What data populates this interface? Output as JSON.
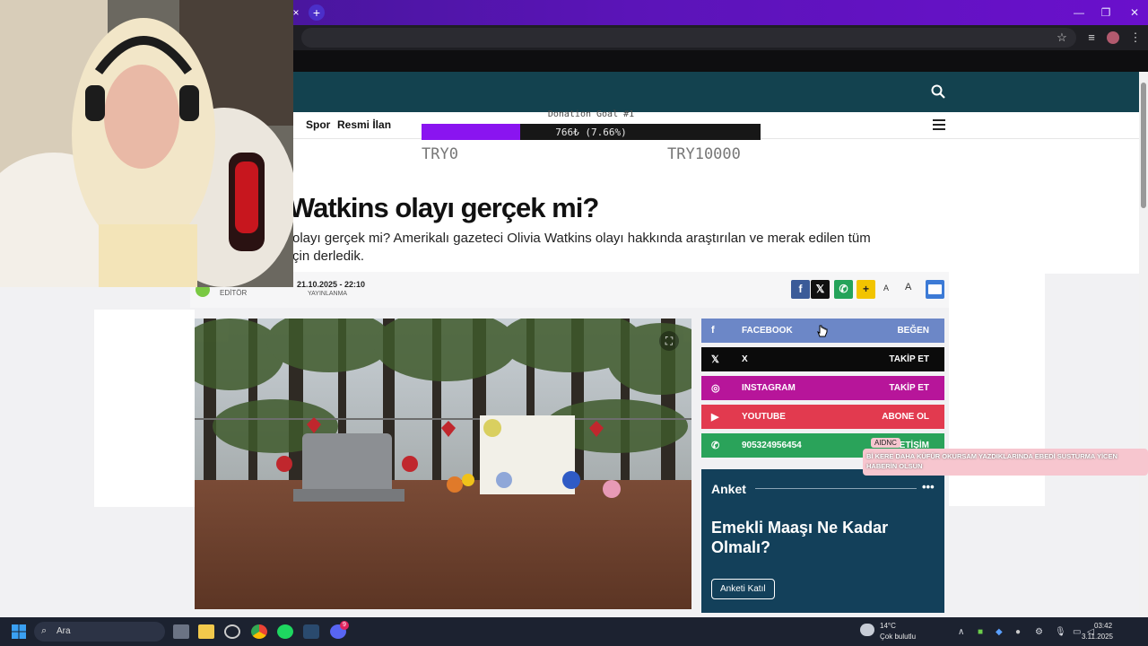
{
  "browser": {
    "tab_close": "×",
    "new_tab": "+",
    "window_buttons": [
      "—",
      "❐",
      "✕"
    ]
  },
  "site": {
    "nav_items": [
      "Spor",
      "Resmi İlan"
    ],
    "search_icon": "search-icon",
    "menu_icon": "hamburger-icon"
  },
  "article": {
    "title": "Watkins olayı gerçek mi?",
    "subtitle_line1": "olayı gerçek mi? Amerikalı gazeteci Olivia Watkins olayı hakkında araştırılan ve merak edilen tüm",
    "subtitle_line2": "çin derledik.",
    "author_role": "EDİTÖR",
    "date": "21.10.2025 - 22:10",
    "date_label": "YAYINLANMA",
    "font_small": "A",
    "font_large": "A",
    "share_buttons": [
      "f",
      "𝕏",
      "✆",
      "+"
    ]
  },
  "social": [
    {
      "icon": "facebook-icon",
      "glyph": "f",
      "name": "FACEBOOK",
      "action": "BEĞEN",
      "color": "#6c87c7"
    },
    {
      "icon": "x-icon",
      "glyph": "𝕏",
      "name": "X",
      "action": "TAKİP ET",
      "color": "#0b0b0b"
    },
    {
      "icon": "instagram-icon",
      "glyph": "◎",
      "name": "INSTAGRAM",
      "action": "TAKİP ET",
      "color": "#b7159a"
    },
    {
      "icon": "youtube-icon",
      "glyph": "▶",
      "name": "YOUTUBE",
      "action": "ABONE OL",
      "color": "#e23a4f"
    },
    {
      "icon": "whatsapp-icon",
      "glyph": "✆",
      "name": "905324956454",
      "action": "İLETİŞİM",
      "color": "#2aa35a"
    }
  ],
  "poll": {
    "header": "Anket",
    "question": "Emekli Maaşı Ne Kadar Olmalı?",
    "button": "Anketi Katıl"
  },
  "stream_overlay": {
    "goal_title": "Donation Goal #1",
    "progress_text": "766₺ (7.66%)",
    "progress_fraction": 0.0766,
    "start_label": "TRY0",
    "end_label": "TRY10000",
    "alert_title": "AIDNC",
    "alert_text": "Bİ KERE DAHA KÜFÜR OKURSAM YAZDIKLARINDA EBEDİ SUSTURMA YİCEN HABERİN OLSUN"
  },
  "taskbar": {
    "search_placeholder": "Ara",
    "weather_temp": "14°C",
    "weather_desc": "Çok bulutlu",
    "time": "03:42",
    "date": "3.11.2025",
    "discord_badge": "9"
  }
}
